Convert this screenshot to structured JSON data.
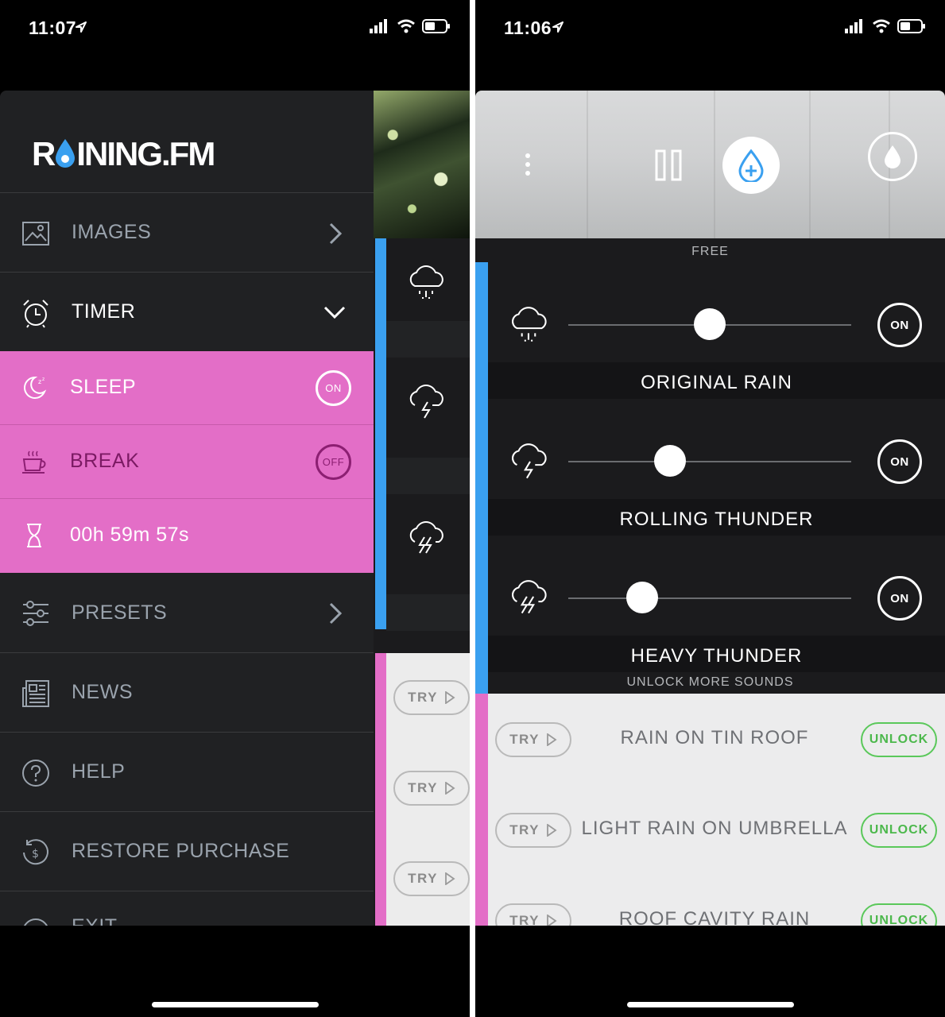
{
  "left_screen": {
    "status": {
      "time": "11:07"
    },
    "logo": {
      "text_before": "R",
      "text_after": "INING.FM"
    },
    "menu": {
      "images": "IMAGES",
      "timer": "TIMER",
      "presets": "PRESETS",
      "news": "NEWS",
      "help": "HELP",
      "restore": "RESTORE PURCHASE",
      "exit": "EXIT"
    },
    "timer": {
      "sleep_label": "SLEEP",
      "sleep_toggle": "ON",
      "break_label": "BREAK",
      "break_toggle": "OFF",
      "countdown": "00h 59m 57s"
    },
    "peek": {
      "try_label": "TRY"
    }
  },
  "right_screen": {
    "status": {
      "time": "11:06"
    },
    "free_label": "FREE",
    "sounds": [
      {
        "name": "ORIGINAL RAIN",
        "toggle": "ON",
        "icon": "cloud-rain-icon",
        "volume": 0.5
      },
      {
        "name": "ROLLING THUNDER",
        "toggle": "ON",
        "icon": "cloud-lightning-icon",
        "volume": 0.36
      },
      {
        "name": "HEAVY THUNDER",
        "toggle": "ON",
        "icon": "cloud-heavy-thunder-icon",
        "volume": 0.26
      }
    ],
    "unlock_more_label": "UNLOCK MORE SOUNDS",
    "locked_sounds": [
      {
        "name": "RAIN ON TIN ROOF",
        "try": "TRY",
        "unlock": "UNLOCK"
      },
      {
        "name": "LIGHT RAIN ON UMBRELLA",
        "try": "TRY",
        "unlock": "UNLOCK"
      },
      {
        "name": "ROOF CAVITY RAIN",
        "try": "TRY",
        "unlock": "UNLOCK"
      }
    ]
  },
  "colors": {
    "accent_blue": "#3aa0f0",
    "accent_pink": "#e36ec7",
    "unlock_green": "#4cb84c",
    "panel_dark": "#202123"
  }
}
